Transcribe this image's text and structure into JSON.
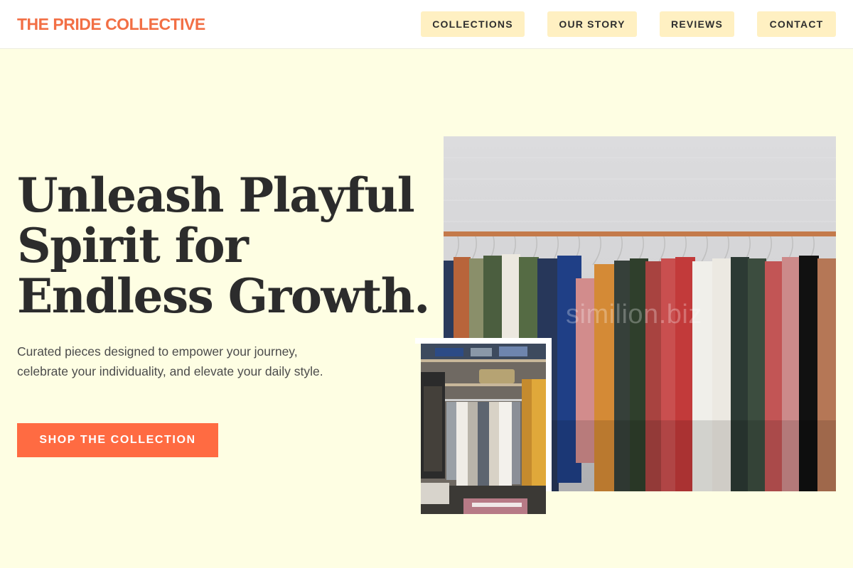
{
  "header": {
    "brand": "THE PRIDE COLLECTIVE",
    "nav": [
      {
        "label": "COLLECTIONS"
      },
      {
        "label": "OUR STORY"
      },
      {
        "label": "REVIEWS"
      },
      {
        "label": "CONTACT"
      }
    ]
  },
  "hero": {
    "headline_lines": [
      "Unleash Playful",
      "Spirit for",
      "Endless Growth."
    ],
    "subtext": "Curated pieces designed to empower your journey, celebrate your individuality, and elevate your daily style.",
    "cta_label": "SHOP THE COLLECTION"
  },
  "images": {
    "main_watermark": "similion.biz"
  },
  "colors": {
    "brand": "#f26f45",
    "background": "#fefee3",
    "nav_button": "#fff0c2",
    "cta": "#ff6b42"
  }
}
